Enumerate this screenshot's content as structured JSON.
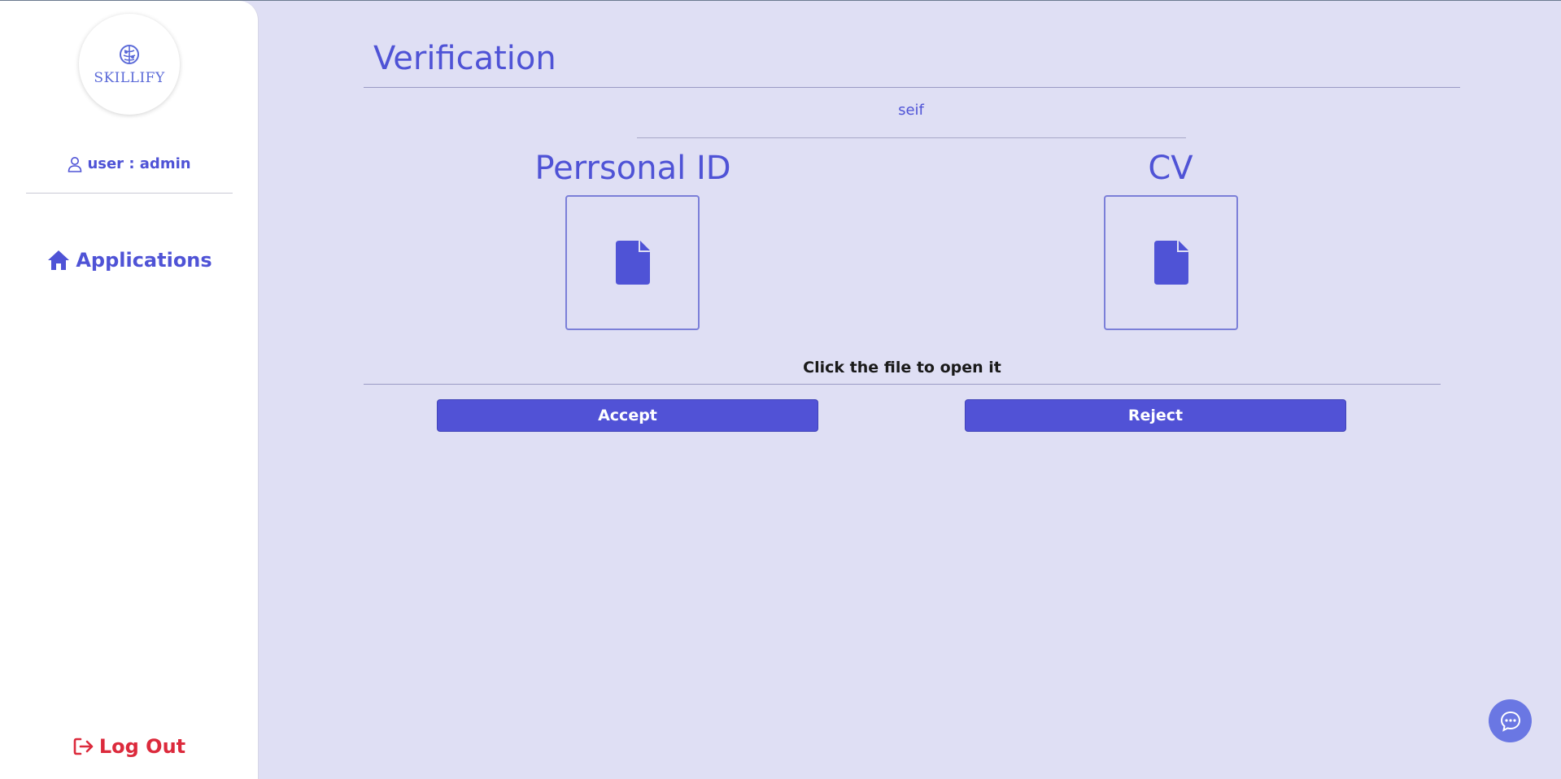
{
  "sidebar": {
    "logo_text": "SKILLIFY",
    "user_label": "user : admin",
    "nav": [
      {
        "label": "Applications",
        "icon": "home-icon"
      }
    ],
    "logout_label": "Log Out"
  },
  "main": {
    "title": "Verification",
    "applicant_name": "seif",
    "documents": [
      {
        "title": "Perrsonal ID",
        "icon": "file-icon"
      },
      {
        "title": "CV",
        "icon": "file-icon"
      }
    ],
    "hint": "Click the file to open it",
    "accept_label": "Accept",
    "reject_label": "Reject"
  },
  "colors": {
    "primary": "#4f53d6",
    "button": "#5152d6",
    "background": "#dfdff4",
    "logout": "#dc2a3c",
    "chat": "#6a77e3"
  }
}
